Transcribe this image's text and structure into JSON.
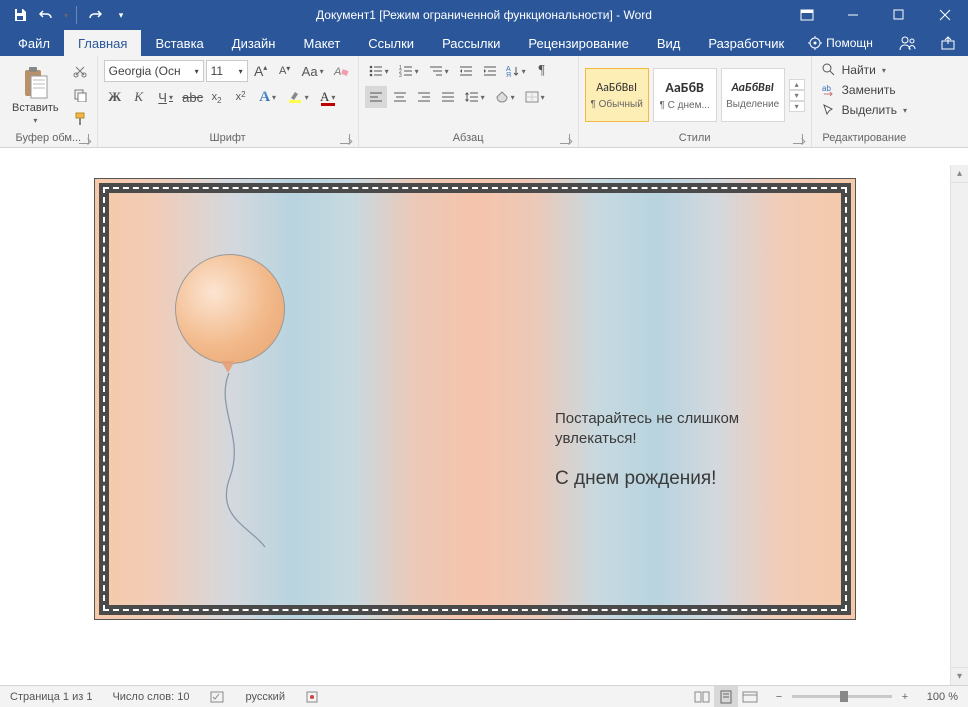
{
  "window": {
    "title": "Документ1 [Режим ограниченной функциональности] - Word",
    "qat": {
      "save": "save",
      "undo": "undo",
      "redo": "redo",
      "more": "▾"
    },
    "winbtns": {
      "ribbon_opts": "▣",
      "min": "—",
      "max": "☐",
      "close": "✕"
    }
  },
  "tabs": {
    "file": "Файл",
    "home": "Главная",
    "insert": "Вставка",
    "design": "Дизайн",
    "layout": "Макет",
    "references": "Ссылки",
    "mailings": "Рассылки",
    "review": "Рецензирование",
    "view": "Вид",
    "developer": "Разработчик",
    "tell": "Помощн"
  },
  "ribbon": {
    "clipboard": {
      "label": "Буфер обм...",
      "paste": "Вставить"
    },
    "font": {
      "label": "Шрифт",
      "name": "Georgia (Осн",
      "size": "11",
      "bold": "Ж",
      "italic": "К",
      "underline": "Ч",
      "strike": "abc",
      "sub": "x₂",
      "sup": "x²",
      "case": "Aa",
      "clear": "🧹",
      "grow": "A",
      "shrink": "A"
    },
    "para": {
      "label": "Абзац"
    },
    "styles": {
      "label": "Стили",
      "s1": {
        "sample": "АаБбВвІ",
        "name": "¶ Обычный"
      },
      "s2": {
        "sample": "АаБбВ",
        "name": "¶ С днем..."
      },
      "s3": {
        "sample": "АаБбВвІ",
        "name": "Выделение"
      }
    },
    "editing": {
      "label": "Редактирование",
      "find": "Найти",
      "replace": "Заменить",
      "select": "Выделить"
    }
  },
  "document": {
    "tagline": "Постарайтесь не слишком увлекаться!",
    "headline": "С днем рождения!"
  },
  "status": {
    "page": "Страница 1 из 1",
    "words": "Число слов: 10",
    "lang": "русский",
    "zoom": "100 %"
  }
}
